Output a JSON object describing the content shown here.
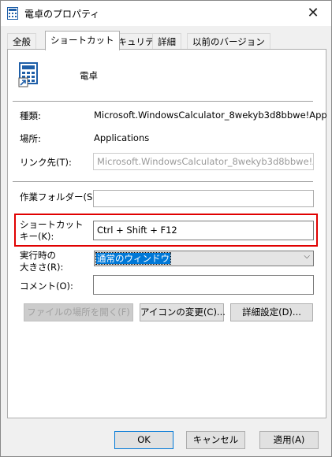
{
  "window": {
    "title": "電卓のプロパティ",
    "close_glyph": "✕"
  },
  "tabs": [
    {
      "label": "全般",
      "active": false
    },
    {
      "label": "ショートカット",
      "active": true
    },
    {
      "label": "セキュリティ",
      "active": false
    },
    {
      "label": "詳細",
      "active": false
    },
    {
      "label": "以前のバージョン",
      "active": false
    }
  ],
  "app": {
    "name": "電卓",
    "icon": "calculator-icon"
  },
  "fields": {
    "type_label": "種類:",
    "type_value": "Microsoft.WindowsCalculator_8wekyb3d8bbwe!App",
    "location_label": "場所:",
    "location_value": "Applications",
    "target_label": "リンク先(T):",
    "target_value": "Microsoft.WindowsCalculator_8wekyb3d8bbwe!App",
    "workdir_label": "作業フォルダー(S):",
    "workdir_value": "",
    "shortcut_label_1": "ショートカット",
    "shortcut_label_2": "キー(K):",
    "shortcut_value": "Ctrl + Shift + F12",
    "run_label_1": "実行時の",
    "run_label_2": "大きさ(R):",
    "run_value": "通常のウィンドウ",
    "comment_label": "コメント(O):",
    "comment_value": ""
  },
  "action_buttons": {
    "open_location": "ファイルの場所を開く(F)",
    "change_icon": "アイコンの変更(C)...",
    "advanced": "詳細設定(D)..."
  },
  "footer_buttons": {
    "ok": "OK",
    "cancel": "キャンセル",
    "apply": "適用(A)"
  },
  "colors": {
    "highlight_border": "#e00000",
    "selection": "#0078d7"
  }
}
